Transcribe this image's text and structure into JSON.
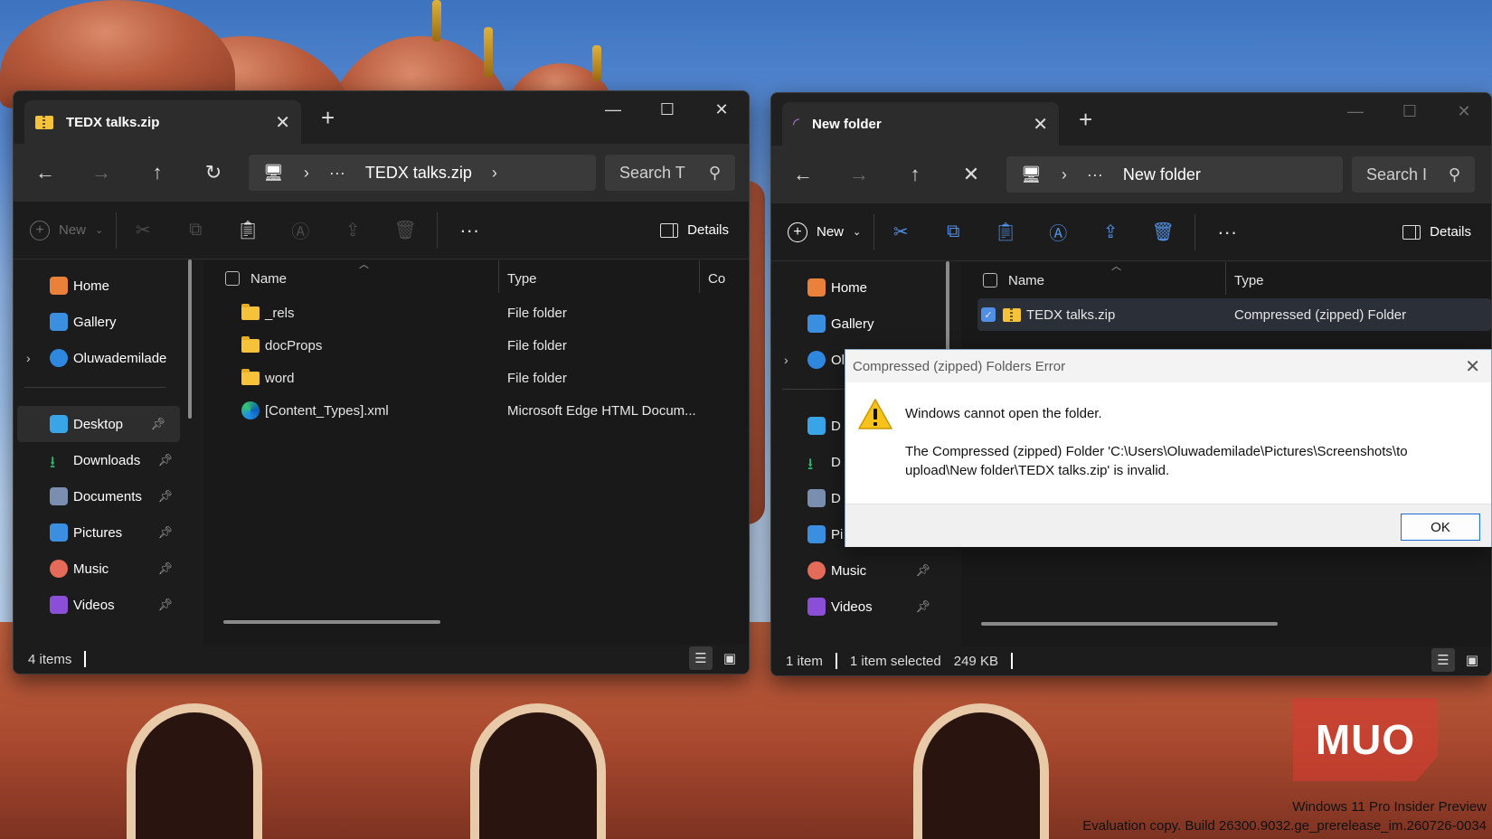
{
  "left_window": {
    "tab_title": "TEDX talks.zip",
    "address": {
      "more": "···",
      "path": "TEDX talks.zip"
    },
    "search_placeholder": "Search T",
    "new_label": "New",
    "details_label": "Details",
    "columns": {
      "name": "Name",
      "type": "Type",
      "extra": "Co"
    },
    "rows": [
      {
        "name": "_rels",
        "type": "File folder",
        "icon": "folder-icon"
      },
      {
        "name": "docProps",
        "type": "File folder",
        "icon": "folder-icon"
      },
      {
        "name": "word",
        "type": "File folder",
        "icon": "folder-icon"
      },
      {
        "name": "[Content_Types].xml",
        "type": "Microsoft Edge HTML Docum...",
        "icon": "edge-icon"
      }
    ],
    "sidebar": [
      {
        "label": "Home",
        "color": "#e9813a"
      },
      {
        "label": "Gallery",
        "color": "#3b8fe0"
      },
      {
        "label": "Oluwademilade",
        "color": "#2f88e0"
      },
      {
        "label": "Desktop",
        "color": "#3aa4e8"
      },
      {
        "label": "Downloads",
        "color": "#2fb36f"
      },
      {
        "label": "Documents",
        "color": "#7a8fb0"
      },
      {
        "label": "Pictures",
        "color": "#3b8fe0"
      },
      {
        "label": "Music",
        "color": "#e46b5a"
      },
      {
        "label": "Videos",
        "color": "#8a4fd6"
      }
    ],
    "status": {
      "count": "4 items"
    }
  },
  "right_window": {
    "tab_title": "New folder",
    "address": {
      "more": "···",
      "path": "New folder"
    },
    "search_placeholder": "Search I",
    "new_label": "New",
    "details_label": "Details",
    "columns": {
      "name": "Name",
      "type": "Type"
    },
    "rows": [
      {
        "name": "TEDX talks.zip",
        "type": "Compressed (zipped) Folder",
        "icon": "zip-folder-icon"
      }
    ],
    "sidebar": [
      {
        "label": "Home",
        "color": "#e9813a"
      },
      {
        "label": "Gallery",
        "color": "#3b8fe0"
      },
      {
        "label": "Ol",
        "color": "#2f88e0"
      },
      {
        "label": "D",
        "color": "#3aa4e8"
      },
      {
        "label": "D",
        "color": "#2fb36f"
      },
      {
        "label": "D",
        "color": "#7a8fb0"
      },
      {
        "label": "Pi",
        "color": "#3b8fe0"
      },
      {
        "label": "Music",
        "color": "#e46b5a"
      },
      {
        "label": "Videos",
        "color": "#8a4fd6"
      }
    ],
    "status": {
      "count": "1 item",
      "selected": "1 item selected",
      "size": "249 KB"
    }
  },
  "dialog": {
    "title": "Compressed (zipped) Folders Error",
    "message": "Windows cannot open the folder.",
    "detail": "The Compressed (zipped) Folder 'C:\\Users\\Oluwademilade\\Pictures\\Screenshots\\to upload\\New folder\\TEDX talks.zip' is invalid.",
    "ok_label": "OK"
  },
  "watermark": {
    "line1": "Windows 11 Pro Insider Preview",
    "line2": "Evaluation copy. Build 26300.9032.ge_prerelease_im.260726-0034",
    "logo": "MUO"
  },
  "colors": {
    "accent": "#4f8fe6",
    "window_bg": "#1c1c1c",
    "dialog_button_border": "#1a6fd6"
  }
}
